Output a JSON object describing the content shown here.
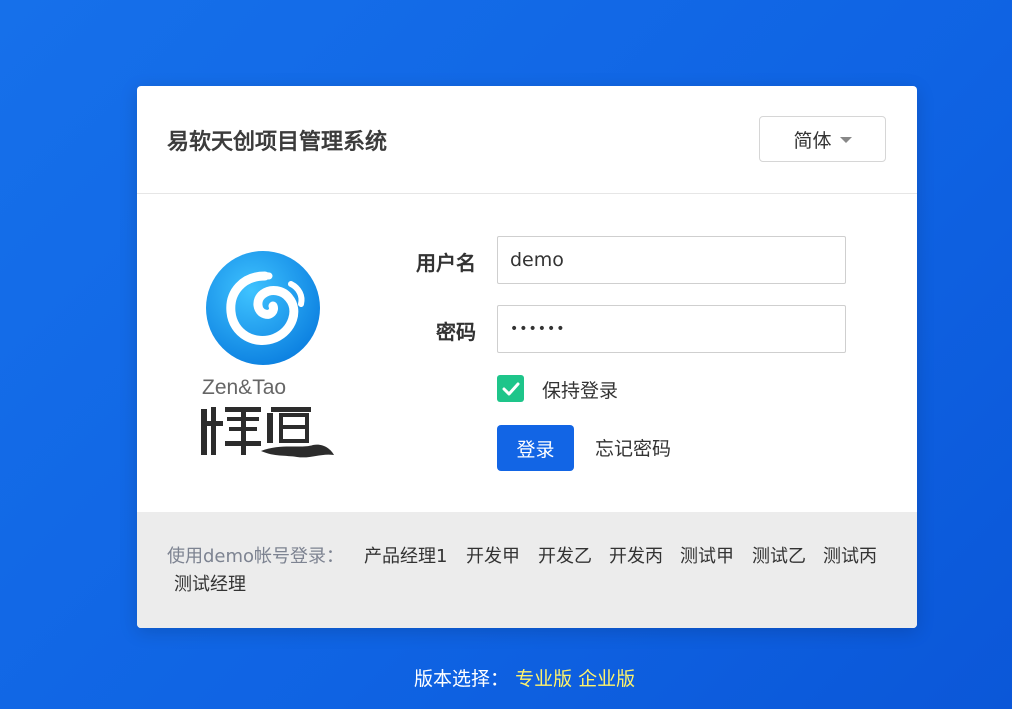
{
  "header": {
    "title": "易软天创项目管理系统",
    "language": "简体"
  },
  "logo": {
    "text": "Zen&Tao",
    "chinese_text": "禪道"
  },
  "form": {
    "username_label": "用户名",
    "username_value": "demo",
    "password_label": "密码",
    "password_value": "••••••",
    "remember_label": "保持登录",
    "remember_checked": true,
    "login_button": "登录",
    "forgot_link": "忘记密码"
  },
  "demo_accounts": {
    "prefix": "使用demo帐号登录：",
    "accounts": [
      "产品经理1",
      "开发甲",
      "开发乙",
      "开发丙",
      "测试甲",
      "测试乙",
      "测试丙",
      "测试经理"
    ]
  },
  "edition": {
    "label": "版本选择：",
    "pro": "专业版",
    "enterprise": "企业版"
  },
  "colors": {
    "background": "#1268e6",
    "accent": "#1265e5",
    "checkbox": "#1ec58a",
    "edition_link": "#fff36b"
  }
}
